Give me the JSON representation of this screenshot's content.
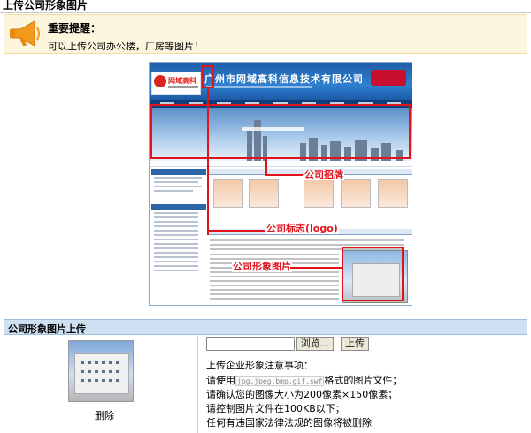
{
  "page": {
    "title": "上传公司形象图片"
  },
  "notice": {
    "heading": "重要提醒：",
    "text": "可以上传公司办公楼，厂房等图片！",
    "icon": "megaphone-icon"
  },
  "preview": {
    "company_name": "广州市网域高科信息技术有限公司",
    "logo_text": "网域高科",
    "callouts": {
      "banner": "公司招牌",
      "logo": "公司标志(logo)",
      "image": "公司形象图片"
    }
  },
  "upload": {
    "section_title": "公司形象图片上传",
    "file_value": "",
    "browse_label": "浏览...",
    "upload_label": "上传",
    "delete_label": "删除",
    "notes_title": "上传企业形象注意事项：",
    "note_format_prefix": "请使用",
    "note_format_inline": "jpg,jpeg,bmp,gif,swf",
    "note_format_suffix": "格式的图片文件；",
    "note_size": "请确认您的图像大小为200像素×150像素；",
    "note_filesize": "请控制图片文件在100KB以下；",
    "note_legal": "任何有违国家法律法规的图像将被删除"
  },
  "colors": {
    "callout": "#e1141c",
    "notice_bg": "#fdf6df",
    "section_header_bg": "#cfe0f3"
  }
}
